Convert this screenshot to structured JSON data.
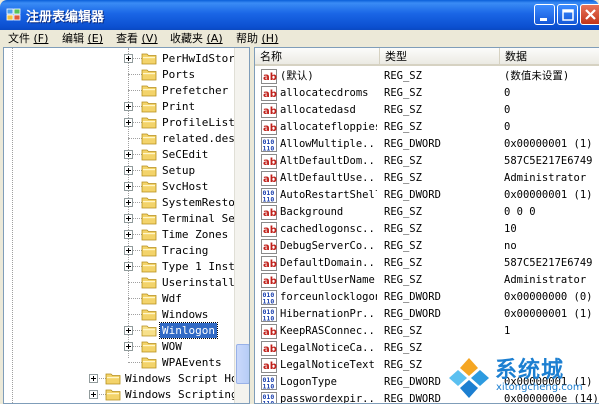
{
  "window": {
    "title": "注册表编辑器"
  },
  "menu": [
    {
      "label": "文件",
      "key": "(F)"
    },
    {
      "label": "编辑",
      "key": "(E)"
    },
    {
      "label": "查看",
      "key": "(V)"
    },
    {
      "label": "收藏夹",
      "key": "(A)"
    },
    {
      "label": "帮助",
      "key": "(H)"
    }
  ],
  "tree": [
    {
      "label": "PerHwIdStora",
      "expander": true
    },
    {
      "label": "Ports",
      "expander": false
    },
    {
      "label": "Prefetcher",
      "expander": false
    },
    {
      "label": "Print",
      "expander": true
    },
    {
      "label": "ProfileList",
      "expander": true
    },
    {
      "label": "related.desc",
      "expander": false
    },
    {
      "label": "SeCEdit",
      "expander": true
    },
    {
      "label": "Setup",
      "expander": true
    },
    {
      "label": "SvcHost",
      "expander": true
    },
    {
      "label": "SystemRestor",
      "expander": true
    },
    {
      "label": "Terminal Ser",
      "expander": true
    },
    {
      "label": "Time Zones",
      "expander": true
    },
    {
      "label": "Tracing",
      "expander": true
    },
    {
      "label": "Type 1 Insta",
      "expander": true
    },
    {
      "label": "Userinstalla",
      "expander": false
    },
    {
      "label": "Wdf",
      "expander": false
    },
    {
      "label": "Windows",
      "expander": false
    },
    {
      "label": "Winlogon",
      "expander": true,
      "selected": true
    },
    {
      "label": "WOW",
      "expander": true
    },
    {
      "label": "WPAEvents",
      "expander": false
    },
    {
      "label": "Windows Script Hos",
      "expander": true,
      "level": 1
    },
    {
      "label": "Windows Scripting",
      "expander": true,
      "level": 1
    }
  ],
  "list": {
    "columns": [
      "名称",
      "类型",
      "数据"
    ],
    "rows": [
      {
        "icon": "ab",
        "name": "(默认)",
        "type": "REG_SZ",
        "data": "(数值未设置)"
      },
      {
        "icon": "ab",
        "name": "allocatecdroms",
        "type": "REG_SZ",
        "data": "0"
      },
      {
        "icon": "ab",
        "name": "allocatedasd",
        "type": "REG_SZ",
        "data": "0"
      },
      {
        "icon": "ab",
        "name": "allocatefloppies",
        "type": "REG_SZ",
        "data": "0"
      },
      {
        "icon": "bin",
        "name": "AllowMultiple...",
        "type": "REG_DWORD",
        "data": "0x00000001 (1)"
      },
      {
        "icon": "ab",
        "name": "AltDefaultDom...",
        "type": "REG_SZ",
        "data": "587C5E217E6749"
      },
      {
        "icon": "ab",
        "name": "AltDefaultUse...",
        "type": "REG_SZ",
        "data": "Administrator"
      },
      {
        "icon": "bin",
        "name": "AutoRestartShell",
        "type": "REG_DWORD",
        "data": "0x00000001 (1)"
      },
      {
        "icon": "ab",
        "name": "Background",
        "type": "REG_SZ",
        "data": "0 0 0"
      },
      {
        "icon": "ab",
        "name": "cachedlogonsc...",
        "type": "REG_SZ",
        "data": "10"
      },
      {
        "icon": "ab",
        "name": "DebugServerCo...",
        "type": "REG_SZ",
        "data": "no"
      },
      {
        "icon": "ab",
        "name": "DefaultDomain...",
        "type": "REG_SZ",
        "data": "587C5E217E6749"
      },
      {
        "icon": "ab",
        "name": "DefaultUserName",
        "type": "REG_SZ",
        "data": "Administrator"
      },
      {
        "icon": "bin",
        "name": "forceunlocklogon",
        "type": "REG_DWORD",
        "data": "0x00000000 (0)"
      },
      {
        "icon": "bin",
        "name": "HibernationPr...",
        "type": "REG_DWORD",
        "data": "0x00000001 (1)"
      },
      {
        "icon": "ab",
        "name": "KeepRASConnec...",
        "type": "REG_SZ",
        "data": "1"
      },
      {
        "icon": "ab",
        "name": "LegalNoticeCa...",
        "type": "REG_SZ",
        "data": ""
      },
      {
        "icon": "ab",
        "name": "LegalNoticeText",
        "type": "REG_SZ",
        "data": ""
      },
      {
        "icon": "bin",
        "name": "LogonType",
        "type": "REG_DWORD",
        "data": "0x00000001 (1)"
      },
      {
        "icon": "bin",
        "name": "passwordexpir...",
        "type": "REG_DWORD",
        "data": "0x0000000e (14)"
      }
    ]
  },
  "watermark": {
    "title": "系统城",
    "subtitle": "xitongcheng.com"
  },
  "colors": {
    "selection": "#316ac5",
    "titlebar": "#0a5fd8",
    "watermark": "#1c7fd1"
  }
}
